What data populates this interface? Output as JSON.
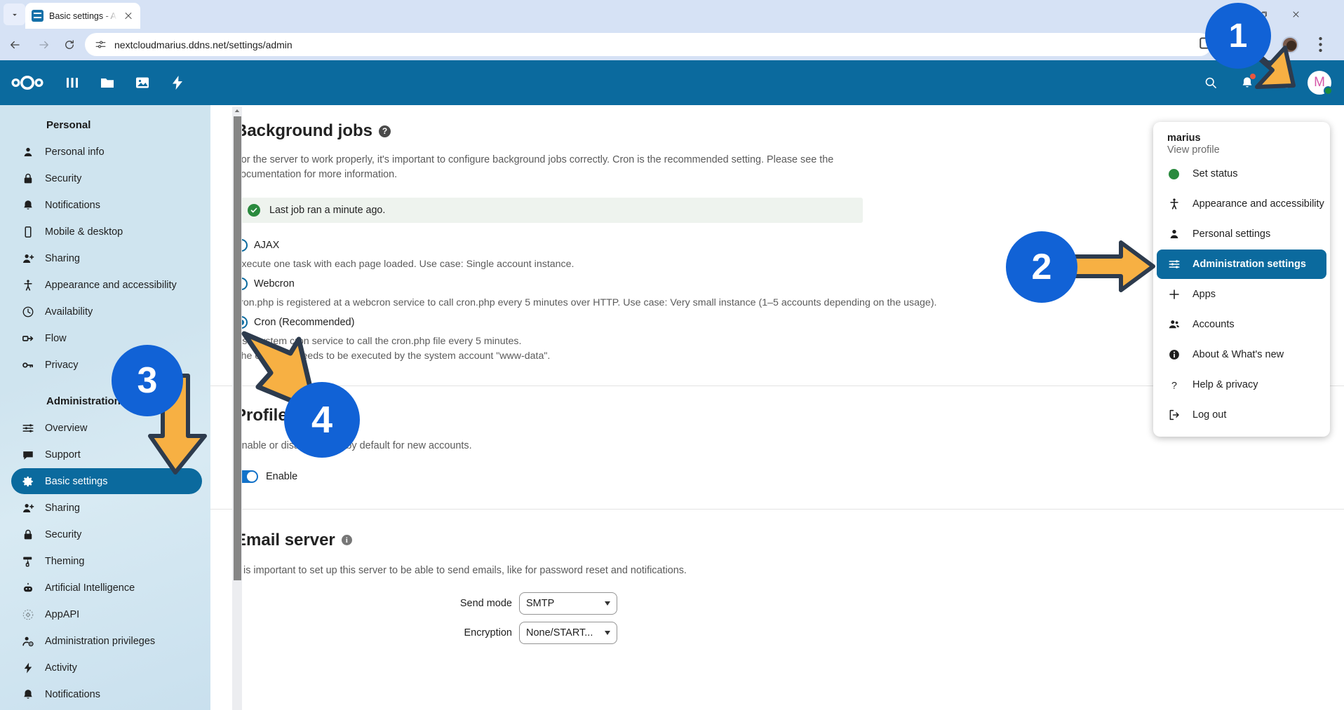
{
  "browser": {
    "tab": {
      "title": "Basic settings - Admin",
      "favicon": "nextcloud-settings-icon",
      "close": "×"
    },
    "url": "nextcloudmarius.ddns.net/settings/admin",
    "nav": {
      "back": "back-icon",
      "forward": "forward-icon",
      "reload": "reload-icon"
    },
    "window": {
      "minimize": "minimize-icon",
      "maximize": "restore-icon",
      "close": "close-icon"
    },
    "right_icons": [
      "install-app-icon",
      "bookmark-star-icon",
      "profile-avatar",
      "chrome-menu-icon"
    ]
  },
  "nc_header": {
    "logo": "nextcloud-logo",
    "apps": [
      "dashboard-icon",
      "files-icon",
      "photos-icon",
      "activity-icon"
    ],
    "right": [
      "search-icon",
      "notifications-icon",
      "contacts-icon"
    ],
    "avatar_letter": "M"
  },
  "sidebar": {
    "personal_title": "Personal",
    "personal_items": [
      {
        "label": "Personal info",
        "icon": "account-icon"
      },
      {
        "label": "Security",
        "icon": "lock-icon"
      },
      {
        "label": "Notifications",
        "icon": "bell-icon"
      },
      {
        "label": "Mobile & desktop",
        "icon": "mobile-icon"
      },
      {
        "label": "Sharing",
        "icon": "share-account-icon"
      },
      {
        "label": "Appearance and accessibility",
        "icon": "accessibility-icon"
      },
      {
        "label": "Availability",
        "icon": "clock-icon"
      },
      {
        "label": "Flow",
        "icon": "flow-icon"
      },
      {
        "label": "Privacy",
        "icon": "key-icon"
      }
    ],
    "admin_title": "Administration",
    "admin_items": [
      {
        "label": "Overview",
        "icon": "sliders-icon",
        "active": false
      },
      {
        "label": "Support",
        "icon": "chat-icon",
        "active": false
      },
      {
        "label": "Basic settings",
        "icon": "gear-icon",
        "active": true
      },
      {
        "label": "Sharing",
        "icon": "share-account-icon",
        "active": false
      },
      {
        "label": "Security",
        "icon": "lock-icon",
        "active": false
      },
      {
        "label": "Theming",
        "icon": "paint-roller-icon",
        "active": false
      },
      {
        "label": "Artificial Intelligence",
        "icon": "robot-icon",
        "active": false
      },
      {
        "label": "AppAPI",
        "icon": "appapi-icon",
        "active": false
      },
      {
        "label": "Administration privileges",
        "icon": "account-cog-icon",
        "active": false
      },
      {
        "label": "Activity",
        "icon": "lightning-icon",
        "active": false
      },
      {
        "label": "Notifications",
        "icon": "bell-icon",
        "active": false
      }
    ]
  },
  "background_jobs": {
    "title": "Background jobs",
    "help_icon": "?",
    "description": "For the server to work properly, it's important to configure background jobs correctly. Cron is the recommended setting. Please see the documentation for more information.",
    "status": "Last job ran a minute ago.",
    "status_icon": "check-circle-icon",
    "options": [
      {
        "label": "AJAX",
        "checked": false,
        "desc": "Execute one task with each page loaded. Use case: Single account instance."
      },
      {
        "label": "Webcron",
        "checked": false,
        "desc": "cron.php is registered at a webcron service to call cron.php every 5 minutes over HTTP. Use case: Very small instance (1–5 accounts depending on the usage)."
      },
      {
        "label": "Cron (Recommended)",
        "checked": true,
        "desc": "Use system cron service to call the cron.php file every 5 minutes.",
        "desc2": "The cron.php needs to be executed by the system account \"www-data\"."
      }
    ]
  },
  "profile": {
    "title": "Profile",
    "description": "Enable or disable profile by default for new accounts.",
    "toggle_label": "Enable",
    "toggle_on": true
  },
  "email_server": {
    "title": "Email server",
    "info_icon": "i",
    "description": "It is important to set up this server to be able to send emails, like for password reset and notifications.",
    "fields": [
      {
        "label": "Send mode",
        "value": "SMTP"
      },
      {
        "label": "Encryption",
        "value": "None/START..."
      }
    ]
  },
  "user_menu": {
    "name": "marius",
    "view_profile": "View profile",
    "items": [
      {
        "label": "Set status",
        "icon": "status-dot-icon",
        "active": false
      },
      {
        "label": "Appearance and accessibility",
        "icon": "accessibility-icon",
        "active": false
      },
      {
        "label": "Personal settings",
        "icon": "account-icon",
        "active": false
      },
      {
        "label": "Administration settings",
        "icon": "sliders-icon",
        "active": true
      },
      {
        "label": "Apps",
        "icon": "plus-icon",
        "active": false
      },
      {
        "label": "Accounts",
        "icon": "accounts-icon",
        "active": false
      },
      {
        "label": "About & What's new",
        "icon": "info-icon",
        "active": false
      },
      {
        "label": "Help & privacy",
        "icon": "question-icon",
        "active": false
      },
      {
        "label": "Log out",
        "icon": "logout-icon",
        "active": false
      }
    ]
  },
  "annotations": [
    {
      "number": "1"
    },
    {
      "number": "2"
    },
    {
      "number": "3"
    },
    {
      "number": "4"
    }
  ],
  "colors": {
    "accent": "#0b6a9e",
    "annotation_blue": "#1162d6",
    "annotation_orange": "#f7b043",
    "success_green": "#2a8a3e"
  }
}
